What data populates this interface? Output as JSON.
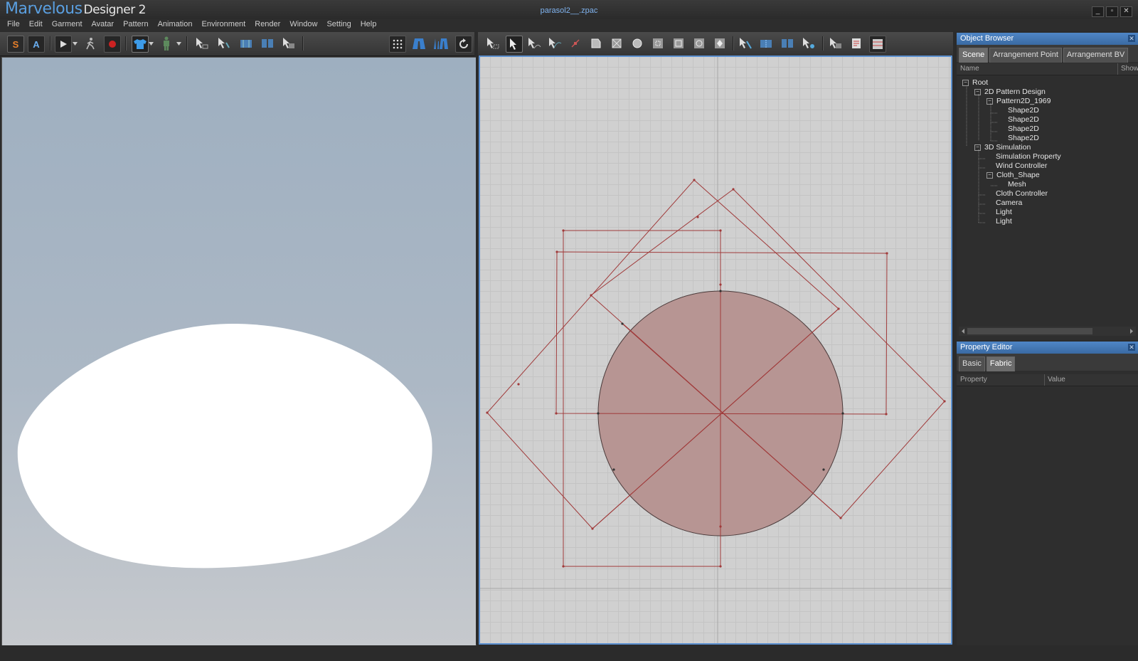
{
  "app": {
    "logo_main": "Marvelous",
    "logo_sub": "Designer 2",
    "doc_title": "parasol2__.zpac"
  },
  "window_controls": [
    "_",
    "▫",
    "✕"
  ],
  "menu": [
    "File",
    "Edit",
    "Garment",
    "Avatar",
    "Pattern",
    "Animation",
    "Environment",
    "Render",
    "Window",
    "Setting",
    "Help"
  ],
  "toolbar_left_letters": {
    "simulate": "S",
    "animate": "A"
  },
  "object_browser": {
    "title": "Object Browser",
    "tabs": [
      "Scene",
      "Arrangement Point",
      "Arrangement BV"
    ],
    "columns": {
      "name": "Name",
      "show": "Show"
    },
    "tree": [
      {
        "label": "Root",
        "toggle": "−"
      },
      {
        "label": "2D Pattern Design",
        "toggle": "−"
      },
      {
        "label": "Pattern2D_1969",
        "toggle": "−"
      },
      {
        "label": "Shape2D"
      },
      {
        "label": "Shape2D"
      },
      {
        "label": "Shape2D"
      },
      {
        "label": "Shape2D"
      },
      {
        "label": "3D Simulation",
        "toggle": "−"
      },
      {
        "label": "Simulation Property"
      },
      {
        "label": "Wind Controller"
      },
      {
        "label": "Cloth_Shape",
        "toggle": "−"
      },
      {
        "label": "Mesh"
      },
      {
        "label": "Cloth Controller"
      },
      {
        "label": "Camera"
      },
      {
        "label": "Light"
      },
      {
        "label": "Light"
      }
    ]
  },
  "property_editor": {
    "title": "Property Editor",
    "tabs": [
      "Basic",
      "Fabric"
    ],
    "columns": {
      "property": "Property",
      "value": "Value"
    }
  },
  "colors": {
    "accent": "#4f86c6",
    "pattern_line": "#a03a3a",
    "pattern_fill": "#b79593"
  }
}
